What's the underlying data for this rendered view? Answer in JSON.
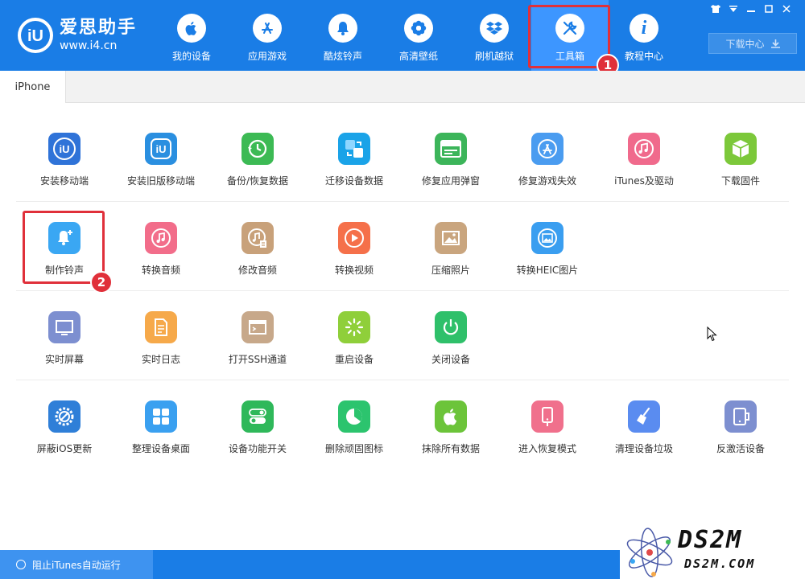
{
  "app": {
    "brand_title": "爱思助手",
    "brand_url": "www.i4.cn",
    "logo_icon": "i4-logo-icon"
  },
  "nav": [
    {
      "label": "我的设备",
      "icon": "apple-icon"
    },
    {
      "label": "应用游戏",
      "icon": "app-store-icon"
    },
    {
      "label": "酷炫铃声",
      "icon": "bell-icon"
    },
    {
      "label": "高清壁纸",
      "icon": "flower-icon"
    },
    {
      "label": "刷机越狱",
      "icon": "dropbox-icon"
    },
    {
      "label": "工具箱",
      "icon": "tools-icon",
      "active": true
    },
    {
      "label": "教程中心",
      "icon": "info-icon"
    }
  ],
  "download_center": "下载中心",
  "tab": "iPhone",
  "tools": [
    [
      {
        "label": "安装移动端",
        "color": "#2f73d8"
      },
      {
        "label": "安装旧版移动端",
        "color": "#2a8fe0"
      },
      {
        "label": "备份/恢复数据",
        "color": "#3cba54"
      },
      {
        "label": "迁移设备数据",
        "color": "#1aa3e8"
      },
      {
        "label": "修复应用弹窗",
        "color": "#3cb55a"
      },
      {
        "label": "修复游戏失效",
        "color": "#4a9cf0"
      },
      {
        "label": "iTunes及驱动",
        "color": "#f06a8c"
      },
      {
        "label": "下载固件",
        "color": "#7cc83a"
      }
    ],
    [
      {
        "label": "制作铃声",
        "color": "#3aa7f3"
      },
      {
        "label": "转换音频",
        "color": "#f26d8a"
      },
      {
        "label": "修改音频",
        "color": "#c8a17a"
      },
      {
        "label": "转换视频",
        "color": "#f5704a"
      },
      {
        "label": "压缩照片",
        "color": "#c9a57e"
      },
      {
        "label": "转换HEIC图片",
        "color": "#3a9ef0"
      }
    ],
    [
      {
        "label": "实时屏幕",
        "color": "#7d8fd0"
      },
      {
        "label": "实时日志",
        "color": "#f6a94a"
      },
      {
        "label": "打开SSH通道",
        "color": "#c7a88a"
      },
      {
        "label": "重启设备",
        "color": "#8fcf3a"
      },
      {
        "label": "关闭设备",
        "color": "#2fc06a"
      }
    ],
    [
      {
        "label": "屏蔽iOS更新",
        "color": "#2f7fd8"
      },
      {
        "label": "整理设备桌面",
        "color": "#3aa0f0"
      },
      {
        "label": "设备功能开关",
        "color": "#2fb85a"
      },
      {
        "label": "删除顽固图标",
        "color": "#2cc46e"
      },
      {
        "label": "抹除所有数据",
        "color": "#6cc43a"
      },
      {
        "label": "进入恢复模式",
        "color": "#f0708c"
      },
      {
        "label": "清理设备垃圾",
        "color": "#5a8cf0"
      },
      {
        "label": "反激活设备",
        "color": "#7d8fd0"
      }
    ]
  ],
  "annotations": {
    "step1": "1",
    "step2": "2"
  },
  "status": {
    "itunes_block": "阻止iTunes自动运行"
  },
  "watermark": {
    "title": "DS2M",
    "url": "DS2M.COM"
  }
}
